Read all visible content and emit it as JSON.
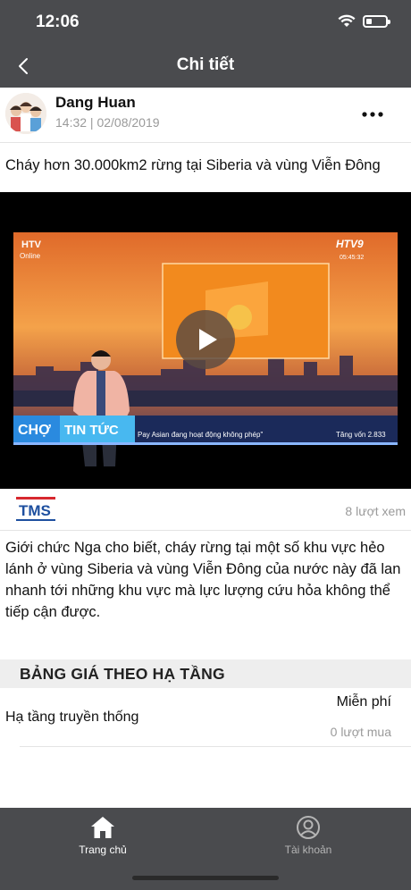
{
  "status_bar": {
    "time": "12:06",
    "battery_level": 0.3
  },
  "nav": {
    "title": "Chi tiết",
    "back_icon": "chevron-left-icon"
  },
  "post": {
    "author_name": "Dang Huan",
    "timestamp": "14:32 | 02/08/2019",
    "more_icon": "more-horizontal-icon",
    "title": "Cháy hơn 30.000km2 rừng tại Siberia và vùng Viễn Đông",
    "video": {
      "channel_logo_left": "HTV",
      "channel_sub_left": "Online",
      "channel_logo_right": "HTV9",
      "clock": "05:45:32",
      "tag_left": "CHỢ",
      "tag_right": "TIN TỨC",
      "ticker": "Pay Asian đang hoạt động không phép\"",
      "ticker_right": "Tăng vốn 2.833",
      "play_icon": "play-icon"
    },
    "source_logo": "TMS",
    "views": "8 lượt xem",
    "description": "Giới chức Nga cho biết, cháy rừng tại một số khu vực hẻo lánh ở vùng Siberia và vùng Viễn Đông của nước này đã lan nhanh tới những khu vực mà lực lượng cứu hỏa không thể tiếp cận được."
  },
  "pricing": {
    "header": "BẢNG GIÁ THEO HẠ TẦNG",
    "items": [
      {
        "name": "Hạ tầng truyền thống",
        "price": "Miễn phí",
        "purchases": "0 lượt mua"
      }
    ]
  },
  "tabbar": {
    "tabs": [
      {
        "label": "Trang chủ",
        "icon": "home-icon",
        "active": true
      },
      {
        "label": "Tài khoản",
        "icon": "user-icon",
        "active": false
      }
    ]
  },
  "colors": {
    "bar_bg": "#4a4b4e",
    "muted_text": "#9a9a9a",
    "section_bg": "#eeeeee"
  }
}
